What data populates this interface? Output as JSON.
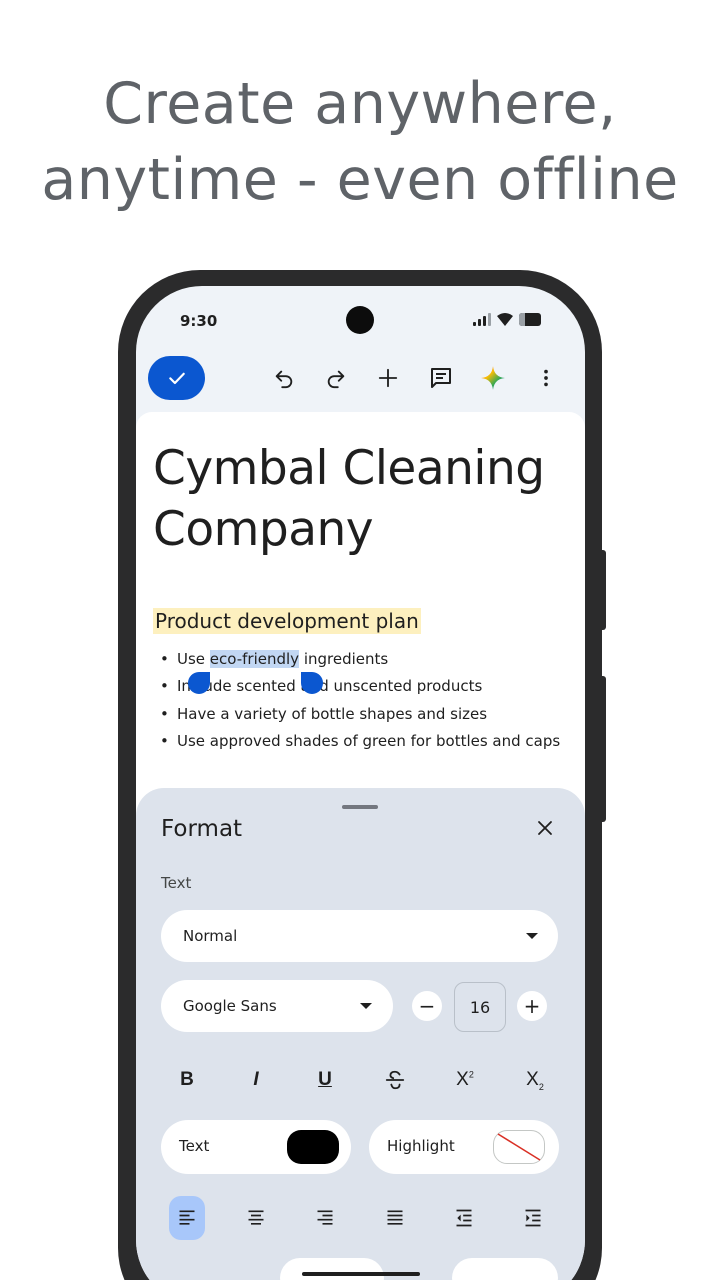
{
  "headline": {
    "line1": "Create anywhere,",
    "line2": "anytime - even offline"
  },
  "status_bar": {
    "time": "9:30",
    "icons": [
      "signal-icon",
      "wifi-icon",
      "battery-icon"
    ]
  },
  "toolbar": {
    "icons": [
      "check-icon",
      "undo-icon",
      "redo-icon",
      "add-icon",
      "comment-icon",
      "gemini-icon",
      "more-vert-icon"
    ]
  },
  "document": {
    "title": "Cymbal Cleaning Company",
    "heading": "Product development plan",
    "bullets": {
      "b1_pre": "Use ",
      "b1_sel": "eco-friendly",
      "b1_post": " ingredients",
      "b2": "Include scented and unscented products",
      "b3": "Have a variety of bottle shapes and sizes",
      "b4": "Use approved shades of green for bottles and caps"
    }
  },
  "format_panel": {
    "title": "Format",
    "text_section_label": "Text",
    "paragraph_style": "Normal",
    "font": "Google Sans",
    "font_size": "16",
    "decrease_label": "−",
    "increase_label": "+",
    "text_color_label": "Text",
    "text_color": "#000000",
    "highlight_label": "Highlight",
    "formatting_buttons": [
      "bold",
      "italic",
      "underline",
      "strikethrough",
      "superscript",
      "subscript"
    ],
    "alignment_buttons": [
      "align-left",
      "align-center",
      "align-right",
      "justify",
      "decrease-indent",
      "increase-indent"
    ],
    "active_alignment": "align-left"
  },
  "colors": {
    "accent": "#0b57d0",
    "selection": "#c2d7f3",
    "heading_highlight": "#fdf0bf",
    "sheet_bg": "#dde3ec"
  }
}
